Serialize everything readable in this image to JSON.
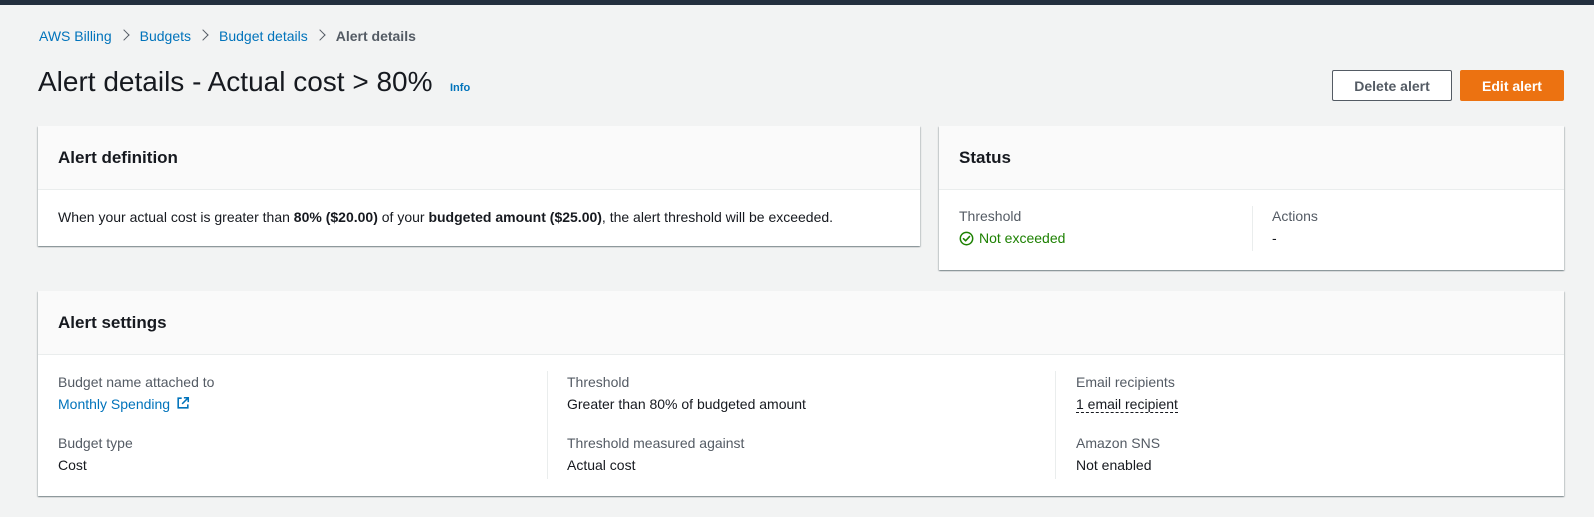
{
  "breadcrumb": {
    "items": [
      "AWS Billing",
      "Budgets",
      "Budget details"
    ],
    "current": "Alert details"
  },
  "header": {
    "title": "Alert details - Actual cost > 80%",
    "info": "Info",
    "delete_label": "Delete alert",
    "edit_label": "Edit alert"
  },
  "alert_definition": {
    "title": "Alert definition",
    "text_1": "When your actual cost is greater than ",
    "bold_1": "80% ($20.00)",
    "text_2": " of your ",
    "bold_2": "budgeted amount ($25.00)",
    "text_3": ", the alert threshold will be exceeded."
  },
  "status": {
    "title": "Status",
    "threshold_label": "Threshold",
    "threshold_value": "Not exceeded",
    "actions_label": "Actions",
    "actions_value": "-"
  },
  "settings": {
    "title": "Alert settings",
    "budget_name_label": "Budget name attached to",
    "budget_name_value": "Monthly Spending",
    "budget_type_label": "Budget type",
    "budget_type_value": "Cost",
    "threshold_label": "Threshold",
    "threshold_value": "Greater than 80% of budgeted amount",
    "measured_label": "Threshold measured against",
    "measured_value": "Actual cost",
    "email_label": "Email recipients",
    "email_value": "1 email recipient",
    "sns_label": "Amazon SNS",
    "sns_value": "Not enabled"
  },
  "icons": {
    "separator": "chevron-right-icon",
    "status_ok": "check-circle-icon",
    "external": "external-link-icon"
  },
  "colors": {
    "link": "#0073bb",
    "primary_button": "#ec7211",
    "success": "#1d8102",
    "top_bar": "#232f3e"
  }
}
